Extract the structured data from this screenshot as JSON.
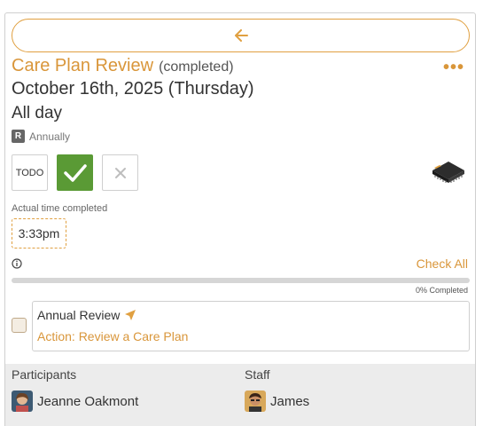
{
  "nav": {
    "back_icon": "arrow-left-icon"
  },
  "event": {
    "title": "Care Plan Review",
    "status": "(completed)",
    "date": "October 16th, 2025 (Thursday)",
    "time": "All day",
    "recurrence_badge": "R",
    "recurrence": "Annually"
  },
  "status_buttons": {
    "todo_label": "TODO",
    "selected": "done"
  },
  "completion": {
    "label": "Actual time completed",
    "time": "3:33pm"
  },
  "checklist": {
    "check_all_label": "Check All",
    "progress_percent": 0,
    "progress_label": "0% Completed",
    "items": [
      {
        "title": "Annual Review",
        "action": "Action: Review a Care Plan",
        "checked": false
      }
    ]
  },
  "people": {
    "participants_label": "Participants",
    "staff_label": "Staff",
    "participant_name": "Jeanne Oakmont",
    "staff_name": "James"
  },
  "colors": {
    "accent": "#d9963a",
    "done_green": "#5a9a35",
    "border": "#cfcfcf"
  }
}
